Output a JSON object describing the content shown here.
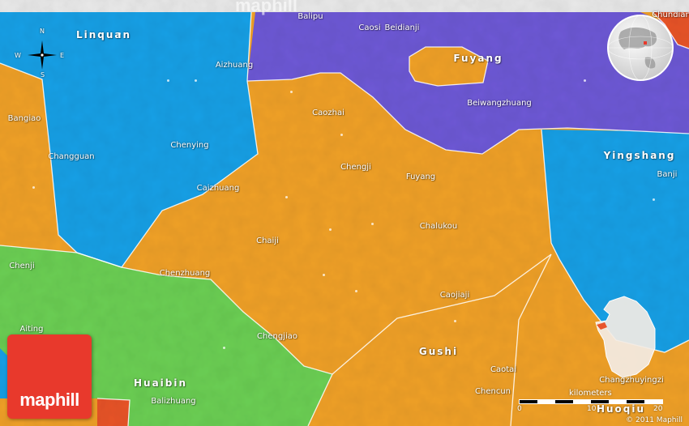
{
  "watermark": "maphill",
  "brand": {
    "name": "maphill"
  },
  "copyright": "© 2011 Maphill",
  "compass": {
    "n": "N",
    "s": "S",
    "e": "E",
    "w": "W"
  },
  "scale": {
    "title": "kilometers",
    "ticks": [
      "0",
      "10",
      "20"
    ]
  },
  "colors": {
    "orange": "#f0a12b",
    "blue": "#1aa0e6",
    "purple": "#6e5ad6",
    "green": "#6ccf54",
    "red": "#e8552c",
    "background": "#e9e9e9"
  },
  "regions": [
    {
      "id": "orange-county",
      "color": "orange"
    },
    {
      "id": "linquan",
      "color": "blue"
    },
    {
      "id": "fuyang",
      "color": "purple"
    },
    {
      "id": "yingshang",
      "color": "blue"
    },
    {
      "id": "huaibin",
      "color": "green"
    }
  ],
  "labels": {
    "big": [
      {
        "name": "Linquan"
      },
      {
        "name": "Fuyang"
      },
      {
        "name": "Yingshang"
      },
      {
        "name": "Gushi"
      },
      {
        "name": "Huaibin"
      },
      {
        "name": "Huoqiu"
      }
    ],
    "places": [
      {
        "name": "Balipu"
      },
      {
        "name": "Caosi"
      },
      {
        "name": "Beidianji"
      },
      {
        "name": "Chundian"
      },
      {
        "name": "Aizhuang"
      },
      {
        "name": "Beiwangzhuang"
      },
      {
        "name": "Caozhai"
      },
      {
        "name": "Bangiao"
      },
      {
        "name": "Changguan"
      },
      {
        "name": "Chenying"
      },
      {
        "name": "Chengji"
      },
      {
        "name": "Fuyang"
      },
      {
        "name": "Banji"
      },
      {
        "name": "Caizhuang"
      },
      {
        "name": "Chalukou"
      },
      {
        "name": "Chaiji"
      },
      {
        "name": "Chenji"
      },
      {
        "name": "Chenzhuang"
      },
      {
        "name": "Caojiaji"
      },
      {
        "name": "Aiting"
      },
      {
        "name": "Chengjiao"
      },
      {
        "name": "Caotai"
      },
      {
        "name": "Changzhuyingzi"
      },
      {
        "name": "Balizhuang"
      },
      {
        "name": "Chencun"
      }
    ]
  }
}
